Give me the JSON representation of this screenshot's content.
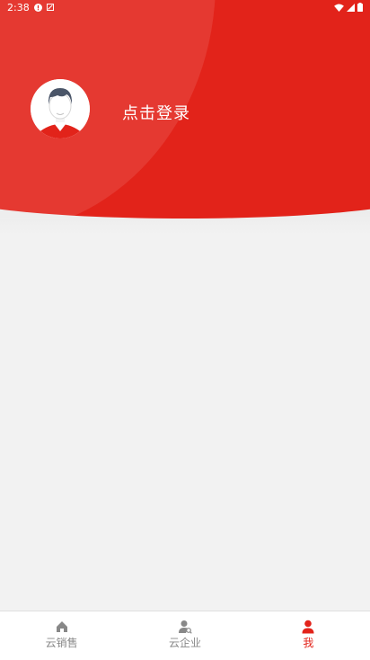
{
  "status_bar": {
    "time": "2:38"
  },
  "profile": {
    "login_text": "点击登录"
  },
  "bottom_nav": {
    "items": [
      {
        "label": "云销售",
        "icon": "home-icon",
        "active": false
      },
      {
        "label": "云企业",
        "icon": "enterprise-user-icon",
        "active": false
      },
      {
        "label": "我",
        "icon": "person-icon",
        "active": true
      }
    ]
  },
  "colors": {
    "brand_red": "#e2231a",
    "inactive_gray": "#888888",
    "page_background": "#f2f2f2"
  }
}
